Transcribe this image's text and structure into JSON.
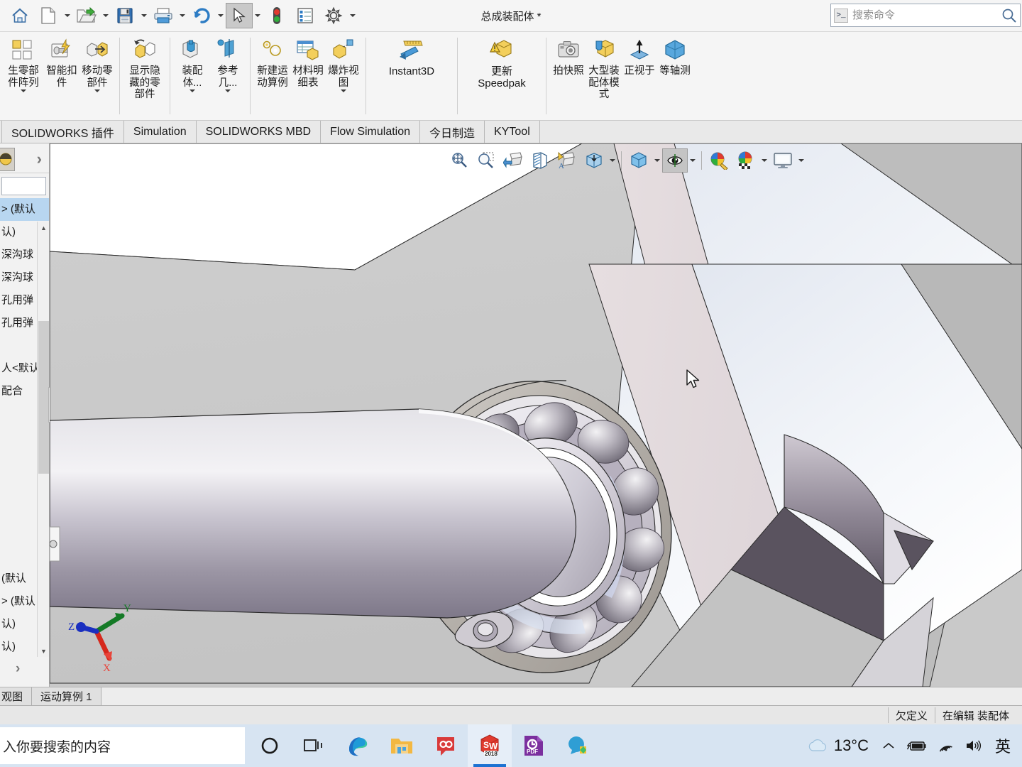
{
  "titlebar": {
    "doc_title": "总成装配体 *",
    "quick_access": [
      {
        "name": "home-icon",
        "label": "主页"
      },
      {
        "name": "new-document-icon",
        "label": "新建"
      },
      {
        "name": "open-folder-icon",
        "label": "打开"
      },
      {
        "name": "save-icon",
        "label": "保存"
      },
      {
        "name": "print-icon",
        "label": "打印"
      },
      {
        "name": "undo-icon",
        "label": "撤销"
      },
      {
        "name": "select-arrow-icon",
        "label": "选择"
      },
      {
        "name": "rebuild-traffic-light-icon",
        "label": "重建模型"
      },
      {
        "name": "options-list-icon",
        "label": "选项列表"
      },
      {
        "name": "gear-settings-icon",
        "label": "选项"
      }
    ],
    "search": {
      "placeholder": "搜索命令",
      "value": "",
      "prefix_icon": "command-prompt-icon",
      "suffix_icon": "magnifier-icon"
    }
  },
  "ribbon": {
    "groups": [
      {
        "items": [
          {
            "label": "生零部件阵列",
            "icon": "component-pattern-icon",
            "caret": true,
            "wide": true
          },
          {
            "label": "智能扣件",
            "icon": "smart-fastener-icon",
            "caret": false
          },
          {
            "label": "移动零部件",
            "icon": "move-component-icon",
            "caret": true
          }
        ]
      },
      {
        "items": [
          {
            "label": "显示隐藏的零部件",
            "icon": "show-hidden-components-icon",
            "caret": false,
            "wide": true
          }
        ]
      },
      {
        "items": [
          {
            "label": "装配体...",
            "icon": "assembly-feature-icon",
            "caret": true
          },
          {
            "label": "参考几...",
            "icon": "reference-geometry-icon",
            "caret": true
          }
        ]
      },
      {
        "items": [
          {
            "label": "新建运动算例",
            "icon": "new-motion-study-icon",
            "caret": false
          },
          {
            "label": "材料明细表",
            "icon": "bill-of-materials-icon",
            "caret": false
          },
          {
            "label": "爆炸视图",
            "icon": "exploded-view-icon",
            "caret": true
          }
        ]
      },
      {
        "items": [
          {
            "label": "Instant3D",
            "icon": "instant3d-icon",
            "caret": false,
            "latin": true
          }
        ]
      },
      {
        "items": [
          {
            "label": "更新 Speedpak",
            "icon": "update-speedpak-icon",
            "caret": false,
            "latin": true
          }
        ]
      },
      {
        "items": [
          {
            "label": "拍快照",
            "icon": "take-snapshot-icon",
            "caret": false
          },
          {
            "label": "大型装配体模式",
            "icon": "large-assembly-mode-icon",
            "caret": false
          },
          {
            "label": "正视于",
            "icon": "normal-to-icon",
            "caret": false
          },
          {
            "label": "等轴测",
            "icon": "isometric-icon",
            "caret": false
          }
        ]
      }
    ]
  },
  "tabs": [
    {
      "label": "SOLIDWORKS 插件",
      "active": false
    },
    {
      "label": "Simulation",
      "active": false
    },
    {
      "label": "SOLIDWORKS MBD",
      "active": false
    },
    {
      "label": "Flow Simulation",
      "active": false
    },
    {
      "label": "今日制造",
      "active": false
    },
    {
      "label": "KYTool",
      "active": false
    }
  ],
  "left_panel": {
    "chevron": "›",
    "bottom_chevron": "›",
    "tree_rows": [
      {
        "text": "> (默认",
        "selected": true
      },
      {
        "text": "认)",
        "selected": false
      },
      {
        "text": "深沟球",
        "selected": false
      },
      {
        "text": "深沟球",
        "selected": false
      },
      {
        "text": "孔用弹",
        "selected": false
      },
      {
        "text": "孔用弹",
        "selected": false
      },
      {
        "text": "",
        "selected": false
      },
      {
        "text": "人<默认",
        "selected": false
      },
      {
        "text": "配合",
        "selected": false
      }
    ],
    "tree_rows_bottom": [
      {
        "text": "(默认",
        "selected": false
      },
      {
        "text": "> (默认",
        "selected": false
      },
      {
        "text": "认)",
        "selected": false
      },
      {
        "text": "认)",
        "selected": false
      }
    ]
  },
  "viewport": {
    "hud_buttons": [
      {
        "name": "zoom-to-fit-icon",
        "caret": false,
        "selected": false
      },
      {
        "name": "zoom-to-area-icon",
        "caret": false,
        "selected": false
      },
      {
        "name": "previous-view-icon",
        "caret": false,
        "selected": false
      },
      {
        "name": "section-view-icon",
        "caret": false,
        "selected": false
      },
      {
        "name": "view-orientation-icon",
        "caret": false,
        "selected": false
      },
      {
        "name": "display-style-icon",
        "caret": true,
        "selected": false
      },
      {
        "name": "view-orientation-cube-icon",
        "caret": true,
        "selected": false
      },
      {
        "name": "hide-show-items-icon",
        "caret": true,
        "selected": true
      },
      {
        "name": "edit-appearance-icon",
        "caret": false,
        "selected": false
      },
      {
        "name": "apply-scene-icon",
        "caret": true,
        "selected": false
      },
      {
        "name": "view-settings-icon",
        "caret": true,
        "selected": false
      }
    ],
    "triad": {
      "x_label": "X",
      "y_label": "Y",
      "z_label": "Z",
      "x_color": "#e02020",
      "y_color": "#0f9b28",
      "z_color": "#1a34d8"
    },
    "background_color": "#c9c9c9",
    "cursor": "arrow-pointer"
  },
  "status_bar": {
    "tabs": [
      {
        "label": "观图"
      },
      {
        "label": "运动算例 1"
      }
    ],
    "cells": [
      {
        "label": "欠定义"
      },
      {
        "label": "在编辑 装配体"
      }
    ]
  },
  "taskbar": {
    "search_text": "入你要搜索的内容",
    "items": [
      {
        "name": "cortana-circle-icon",
        "active": false,
        "underline": false
      },
      {
        "name": "task-view-icon",
        "active": false,
        "underline": false
      },
      {
        "name": "microsoft-edge-icon",
        "active": false,
        "underline": true
      },
      {
        "name": "file-explorer-icon",
        "active": false,
        "underline": true
      },
      {
        "name": "wps-cloud-icon",
        "active": false,
        "underline": true
      },
      {
        "name": "solidworks-2018-icon",
        "active": true,
        "underline": true,
        "badge": "2018"
      },
      {
        "name": "foxit-pdf-icon",
        "active": false,
        "underline": true
      },
      {
        "name": "qq-chat-icon",
        "active": false,
        "underline": true
      }
    ],
    "tray": {
      "weather_icon": "cloud-icon",
      "temperature": "13°C",
      "overflow_icon": "chevron-up-icon",
      "battery_icon": "battery-charging-icon",
      "network_icon": "wifi-icon",
      "volume_icon": "speaker-icon",
      "ime_label": "英"
    }
  },
  "colors": {
    "titlebar_bg": "#f5f5f5",
    "ribbon_bg": "#f5f5f5",
    "tab_bg": "#e9e9e9",
    "viewport_bg": "#c9c9c9",
    "taskbar_bg": "#d7e4f2",
    "selection_blue": "#b8d6f0",
    "accent_blue": "#1d72d2"
  }
}
